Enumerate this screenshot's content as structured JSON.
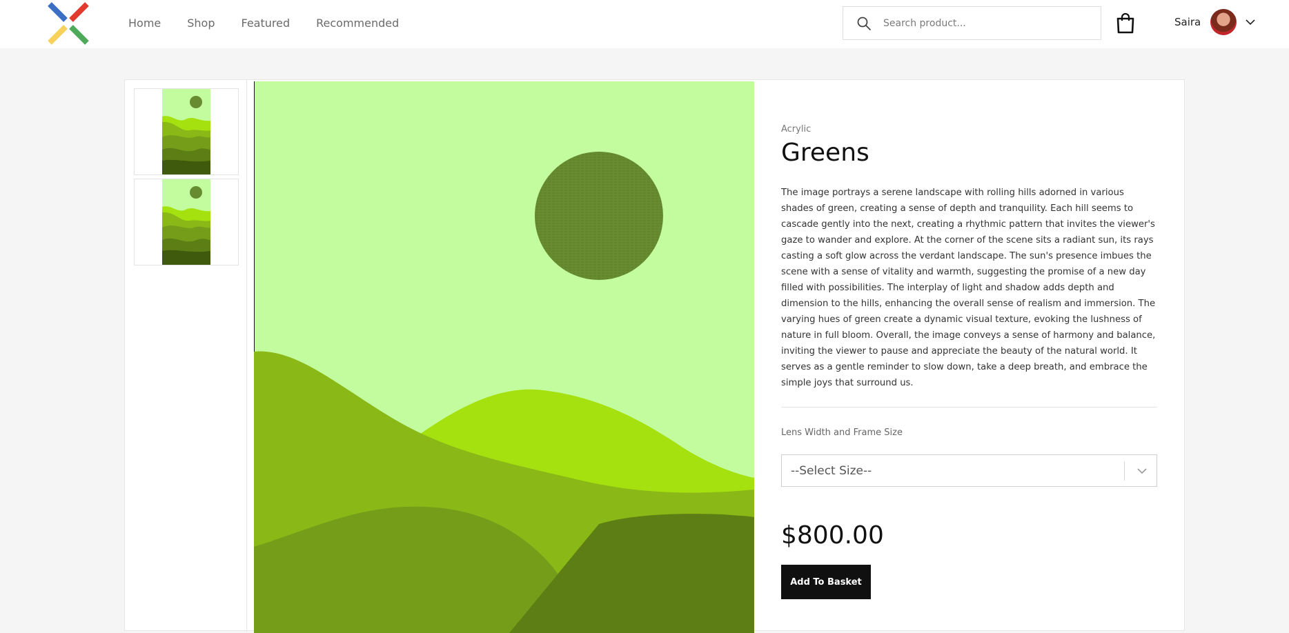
{
  "nav": {
    "items": [
      "Home",
      "Shop",
      "Featured",
      "Recommended"
    ]
  },
  "search": {
    "placeholder": "Search product...",
    "icon": "search-icon"
  },
  "cart": {
    "icon": "shopping-bag-icon"
  },
  "user": {
    "name": "Saira",
    "dropdown_icon": "chevron-down-icon"
  },
  "product": {
    "category": "Acrylic",
    "title": "Greens",
    "description": "The image portrays a serene landscape with rolling hills adorned in various shades of green, creating a sense of depth and tranquility. Each hill seems to cascade gently into the next, creating a rhythmic pattern that invites the viewer's gaze to wander and explore. At the corner of the scene sits a radiant sun, its rays casting a soft glow across the verdant landscape. The sun's presence imbues the scene with a sense of vitality and warmth, suggesting the promise of a new day filled with possibilities. The interplay of light and shadow adds depth and dimension to the hills, enhancing the overall sense of realism and immersion. The varying hues of green create a dynamic visual texture, evoking the lushness of nature in full bloom. Overall, the image conveys a sense of harmony and balance, inviting the viewer to pause and appreciate the beauty of the natural world. It serves as a gentle reminder to slow down, take a deep breath, and embrace the simple joys that surround us.",
    "size_label": "Lens Width and Frame Size",
    "size_select": "--Select Size--",
    "price": "$800.00",
    "add_button": "Add To Basket"
  },
  "colors": {
    "sky": "#c3fc9f",
    "sun": "#668b30",
    "hill_light": "#a5e10e",
    "hill_mid": "#8ab817",
    "hill_dark": "#759d1a",
    "hill_darkest": "#5d7e14",
    "button": "#101010"
  }
}
